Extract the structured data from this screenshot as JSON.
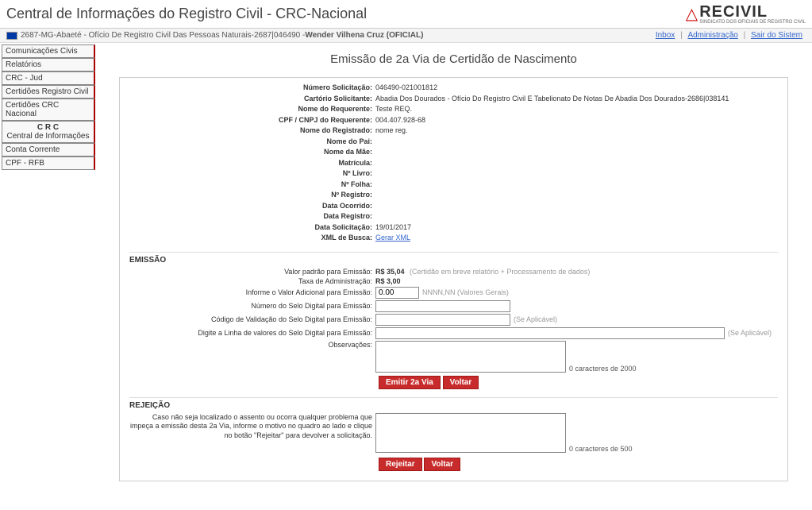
{
  "header": {
    "title": "Central de Informações do Registro Civil - CRC-Nacional",
    "logo_text": "RECIVIL",
    "logo_sub": "SINDICATO DOS OFICIAIS DE REGISTRO CIVIL"
  },
  "crumb": {
    "path": "2687-MG-Abaeté - Ofício De Registro Civil Das Pessoas Naturais-2687|046490 - ",
    "user": "Wender Vilhena Cruz (OFICIAL)",
    "links": {
      "inbox": "Inbox",
      "admin": "Administração",
      "exit": "Sair do Sistem"
    }
  },
  "sidebar": {
    "items": [
      "Comunicações Civis",
      "Relatórios",
      "CRC - Jud",
      "Certidões Registro Civil",
      "Certidões CRC Nacional"
    ],
    "crc_line1": "C R C",
    "crc_line2": "Central de Informações",
    "tail": [
      "Conta Corrente",
      "CPF - RFB"
    ]
  },
  "page": {
    "title": "Emissão de 2a Via de Certidão de Nascimento"
  },
  "details": {
    "num_sol_label": "Número Solicitação:",
    "num_sol": "046490-021001812",
    "cartorio_label": "Cartório Solicitante:",
    "cartorio": "Abadia Dos Dourados - Ofício Do Registro Civil E Tabelionato De Notas De Abadia Dos Dourados-2686|038141",
    "nome_req_label": "Nome do Requerente:",
    "nome_req": "Teste REQ.",
    "cpf_label": "CPF / CNPJ do Requerente:",
    "cpf": "004.407.928-68",
    "nome_reg_label": "Nome do Registrado:",
    "nome_reg": "nome reg.",
    "nome_pai_label": "Nome do Pai:",
    "nome_pai": "",
    "nome_mae_label": "Nome da Mãe:",
    "nome_mae": "",
    "matricula_label": "Matrícula:",
    "matricula": "",
    "livro_label": "Nº Livro:",
    "livro": "",
    "folha_label": "Nº Folha:",
    "folha": "",
    "registro_label": "Nº Registro:",
    "registro": "",
    "data_oc_label": "Data Ocorrido:",
    "data_oc": "",
    "data_reg_label": "Data Registro:",
    "data_reg": "",
    "data_sol_label": "Data Solicitação:",
    "data_sol": "19/01/2017",
    "xml_label": "XML de Busca:",
    "xml_link": "Gerar XML"
  },
  "emissao": {
    "heading": "EMISSÃO",
    "valor_padrao_label": "Valor padrão para Emissão:",
    "valor_padrao": "R$ 35,04",
    "valor_padrao_hint": "(Certidão em breve relatório + Processamento de dados)",
    "taxa_label": "Taxa de Administração:",
    "taxa": "R$ 3,00",
    "valor_adicional_label": "Informe o Valor Adicional para Emissão:",
    "valor_adicional": "0.00",
    "valor_adicional_hint": "NNNN,NN (Valores Gerais)",
    "num_selo_label": "Número do Selo Digital para Emissão:",
    "cod_val_label": "Código de Validação do Selo Digital para Emissão:",
    "se_aplicavel": "(Se Aplicável)",
    "linha_label": "Digite a Linha de valores do Selo Digital para Emissão:",
    "obs_label": "Observações:",
    "counter": "0 caracteres de 2000",
    "btn_emitir": "Emitir 2a Via",
    "btn_voltar": "Voltar"
  },
  "rejeicao": {
    "heading": "REJEIÇÃO",
    "help": "Caso não seja localizado o assento ou ocorra qualquer problema que impeça a emissão desta 2a Via, informe o motivo no quadro ao lado e clique no botão \"Rejeitar\" para devolver a solicitação.",
    "counter": "0 caracteres de 500",
    "btn_rejeitar": "Rejeitar",
    "btn_voltar": "Voltar"
  }
}
